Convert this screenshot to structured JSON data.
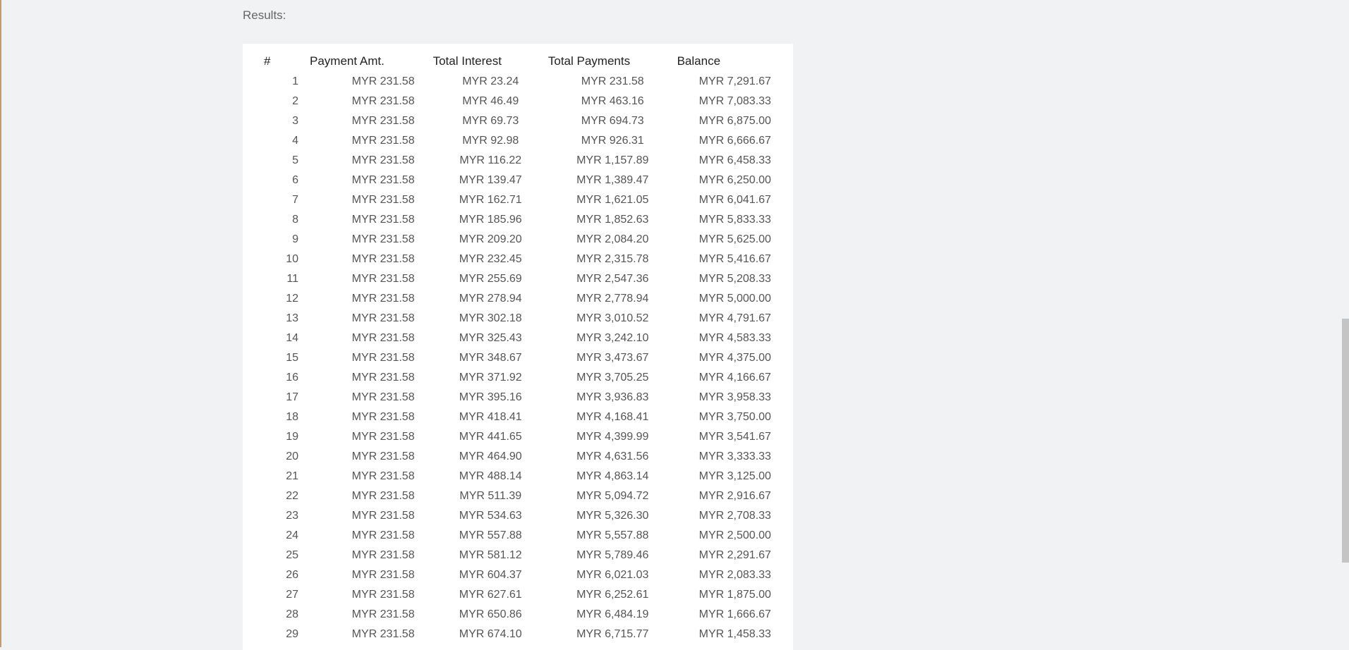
{
  "results_label": "Results:",
  "headers": {
    "num": "#",
    "payment_amt": "Payment Amt.",
    "total_interest": "Total Interest",
    "total_payments": "Total Payments",
    "balance": "Balance"
  },
  "rows": [
    {
      "n": "1",
      "pay": "MYR 231.58",
      "interest": "MYR 23.24",
      "total": "MYR 231.58",
      "balance": "MYR 7,291.67"
    },
    {
      "n": "2",
      "pay": "MYR 231.58",
      "interest": "MYR 46.49",
      "total": "MYR 463.16",
      "balance": "MYR 7,083.33"
    },
    {
      "n": "3",
      "pay": "MYR 231.58",
      "interest": "MYR 69.73",
      "total": "MYR 694.73",
      "balance": "MYR 6,875.00"
    },
    {
      "n": "4",
      "pay": "MYR 231.58",
      "interest": "MYR 92.98",
      "total": "MYR 926.31",
      "balance": "MYR 6,666.67"
    },
    {
      "n": "5",
      "pay": "MYR 231.58",
      "interest": "MYR 116.22",
      "total": "MYR 1,157.89",
      "balance": "MYR 6,458.33"
    },
    {
      "n": "6",
      "pay": "MYR 231.58",
      "interest": "MYR 139.47",
      "total": "MYR 1,389.47",
      "balance": "MYR 6,250.00"
    },
    {
      "n": "7",
      "pay": "MYR 231.58",
      "interest": "MYR 162.71",
      "total": "MYR 1,621.05",
      "balance": "MYR 6,041.67"
    },
    {
      "n": "8",
      "pay": "MYR 231.58",
      "interest": "MYR 185.96",
      "total": "MYR 1,852.63",
      "balance": "MYR 5,833.33"
    },
    {
      "n": "9",
      "pay": "MYR 231.58",
      "interest": "MYR 209.20",
      "total": "MYR 2,084.20",
      "balance": "MYR 5,625.00"
    },
    {
      "n": "10",
      "pay": "MYR 231.58",
      "interest": "MYR 232.45",
      "total": "MYR 2,315.78",
      "balance": "MYR 5,416.67"
    },
    {
      "n": "11",
      "pay": "MYR 231.58",
      "interest": "MYR 255.69",
      "total": "MYR 2,547.36",
      "balance": "MYR 5,208.33"
    },
    {
      "n": "12",
      "pay": "MYR 231.58",
      "interest": "MYR 278.94",
      "total": "MYR 2,778.94",
      "balance": "MYR 5,000.00"
    },
    {
      "n": "13",
      "pay": "MYR 231.58",
      "interest": "MYR 302.18",
      "total": "MYR 3,010.52",
      "balance": "MYR 4,791.67"
    },
    {
      "n": "14",
      "pay": "MYR 231.58",
      "interest": "MYR 325.43",
      "total": "MYR 3,242.10",
      "balance": "MYR 4,583.33"
    },
    {
      "n": "15",
      "pay": "MYR 231.58",
      "interest": "MYR 348.67",
      "total": "MYR 3,473.67",
      "balance": "MYR 4,375.00"
    },
    {
      "n": "16",
      "pay": "MYR 231.58",
      "interest": "MYR 371.92",
      "total": "MYR 3,705.25",
      "balance": "MYR 4,166.67"
    },
    {
      "n": "17",
      "pay": "MYR 231.58",
      "interest": "MYR 395.16",
      "total": "MYR 3,936.83",
      "balance": "MYR 3,958.33"
    },
    {
      "n": "18",
      "pay": "MYR 231.58",
      "interest": "MYR 418.41",
      "total": "MYR 4,168.41",
      "balance": "MYR 3,750.00"
    },
    {
      "n": "19",
      "pay": "MYR 231.58",
      "interest": "MYR 441.65",
      "total": "MYR 4,399.99",
      "balance": "MYR 3,541.67"
    },
    {
      "n": "20",
      "pay": "MYR 231.58",
      "interest": "MYR 464.90",
      "total": "MYR 4,631.56",
      "balance": "MYR 3,333.33"
    },
    {
      "n": "21",
      "pay": "MYR 231.58",
      "interest": "MYR 488.14",
      "total": "MYR 4,863.14",
      "balance": "MYR 3,125.00"
    },
    {
      "n": "22",
      "pay": "MYR 231.58",
      "interest": "MYR 511.39",
      "total": "MYR 5,094.72",
      "balance": "MYR 2,916.67"
    },
    {
      "n": "23",
      "pay": "MYR 231.58",
      "interest": "MYR 534.63",
      "total": "MYR 5,326.30",
      "balance": "MYR 2,708.33"
    },
    {
      "n": "24",
      "pay": "MYR 231.58",
      "interest": "MYR 557.88",
      "total": "MYR 5,557.88",
      "balance": "MYR 2,500.00"
    },
    {
      "n": "25",
      "pay": "MYR 231.58",
      "interest": "MYR 581.12",
      "total": "MYR 5,789.46",
      "balance": "MYR 2,291.67"
    },
    {
      "n": "26",
      "pay": "MYR 231.58",
      "interest": "MYR 604.37",
      "total": "MYR 6,021.03",
      "balance": "MYR 2,083.33"
    },
    {
      "n": "27",
      "pay": "MYR 231.58",
      "interest": "MYR 627.61",
      "total": "MYR 6,252.61",
      "balance": "MYR 1,875.00"
    },
    {
      "n": "28",
      "pay": "MYR 231.58",
      "interest": "MYR 650.86",
      "total": "MYR 6,484.19",
      "balance": "MYR 1,666.67"
    },
    {
      "n": "29",
      "pay": "MYR 231.58",
      "interest": "MYR 674.10",
      "total": "MYR 6,715.77",
      "balance": "MYR 1,458.33"
    }
  ]
}
